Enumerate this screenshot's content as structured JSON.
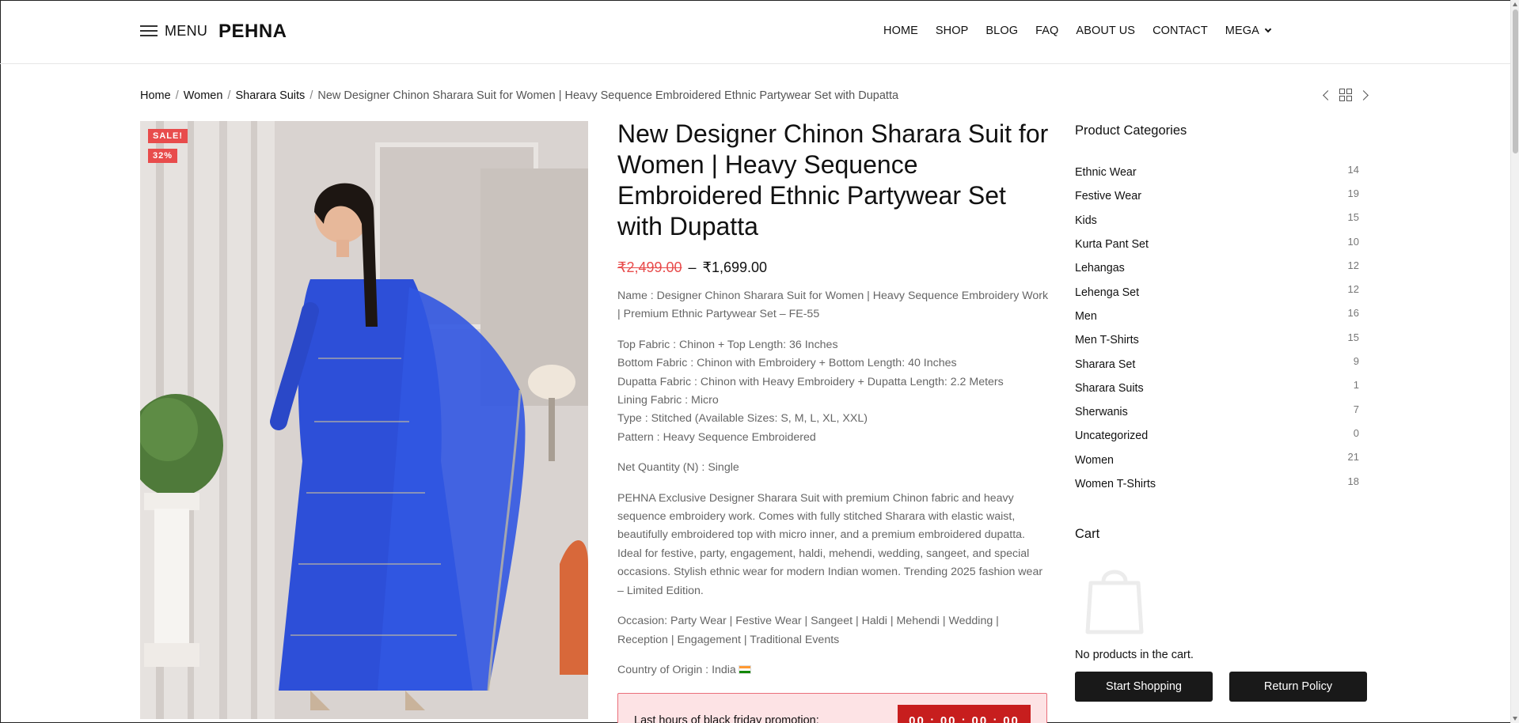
{
  "header": {
    "menu_label": "MENU",
    "logo": "PEHNA",
    "nav": [
      "HOME",
      "SHOP",
      "BLOG",
      "FAQ",
      "ABOUT US",
      "CONTACT",
      "MEGA"
    ]
  },
  "breadcrumb": {
    "items": [
      "Home",
      "Women",
      "Sharara Suits"
    ],
    "current": "New Designer Chinon Sharara Suit for Women | Heavy Sequence Embroidered Ethnic Partywear Set with Dupatta"
  },
  "product": {
    "badges": {
      "sale": "SALE!",
      "discount": "32%"
    },
    "title": "New Designer Chinon Sharara Suit for Women | Heavy Sequence Embroidered Ethnic Partywear Set with Dupatta",
    "price_old": "₹2,499.00",
    "price_sep": "–",
    "price_new": "₹1,699.00",
    "desc": {
      "name": "Name : Designer Chinon Sharara Suit for Women | Heavy Sequence Embroidery Work | Premium Ethnic Partywear Set – FE-55",
      "specs": [
        "Top Fabric : Chinon + Top Length: 36 Inches",
        "Bottom Fabric : Chinon with Embroidery + Bottom Length: 40 Inches",
        "Dupatta Fabric : Chinon with Heavy Embroidery + Dupatta Length: 2.2 Meters",
        "Lining Fabric : Micro",
        "Type : Stitched (Available Sizes: S, M, L, XL, XXL)",
        "Pattern : Heavy Sequence Embroidered"
      ],
      "net_quantity": "Net Quantity (N) : Single",
      "about": "PEHNA Exclusive Designer Sharara Suit with premium Chinon fabric and heavy sequence embroidery work. Comes with fully stitched Sharara with elastic waist, beautifully embroidered top with micro inner, and a premium embroidered dupatta. Ideal for festive, party, engagement, haldi, mehendi, wedding, sangeet, and special occasions. Stylish ethnic wear for modern Indian women. Trending 2025 fashion wear – Limited Edition.",
      "occasion": "Occasion: Party Wear | Festive Wear | Sangeet | Haldi | Mehendi | Wedding | Reception | Engagement | Traditional Events",
      "origin": "Country of Origin : India"
    },
    "promo": {
      "text": "Last hours of black friday promotion:",
      "timer": [
        "00",
        "00",
        "00",
        "00"
      ],
      "timer_sep": ":"
    },
    "image_colors": {
      "dress": "#2d4fd8",
      "background": "#d8d2cf"
    }
  },
  "sidebar": {
    "categories_title": "Product Categories",
    "categories": [
      {
        "name": "Ethnic Wear",
        "count": "14"
      },
      {
        "name": "Festive Wear",
        "count": "19"
      },
      {
        "name": "Kids",
        "count": "15"
      },
      {
        "name": "Kurta Pant Set",
        "count": "10"
      },
      {
        "name": "Lehangas",
        "count": "12"
      },
      {
        "name": "Lehenga Set",
        "count": "12"
      },
      {
        "name": "Men",
        "count": "16"
      },
      {
        "name": "Men T-Shirts",
        "count": "15"
      },
      {
        "name": "Sharara Set",
        "count": "9"
      },
      {
        "name": "Sharara Suits",
        "count": "1"
      },
      {
        "name": "Sherwanis",
        "count": "7"
      },
      {
        "name": "Uncategorized",
        "count": "0"
      },
      {
        "name": "Women",
        "count": "21"
      },
      {
        "name": "Women T-Shirts",
        "count": "18"
      }
    ],
    "cart_title": "Cart",
    "cart_empty": "No products in the cart.",
    "btn_start": "Start Shopping",
    "btn_return": "Return Policy"
  },
  "icons": {
    "menu": "hamburger-icon",
    "prev": "chevron-left-icon",
    "grid": "grid-icon",
    "next": "chevron-right-icon",
    "cart": "shopping-bag-icon",
    "flag": "india-flag-icon"
  },
  "colors": {
    "accent_red": "#e84c4c",
    "promo_bg": "#fde3e5",
    "timer_bg": "#c71e1e",
    "button_bg": "#191919"
  }
}
